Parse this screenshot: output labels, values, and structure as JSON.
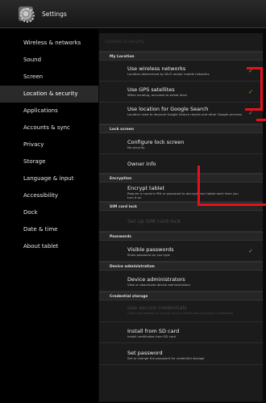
{
  "app": {
    "title": "Settings",
    "icon": "settings-gear-icon"
  },
  "sidebar": {
    "items": [
      {
        "label": "Wireless & networks"
      },
      {
        "label": "Sound"
      },
      {
        "label": "Screen"
      },
      {
        "label": "Location & security",
        "selected": true
      },
      {
        "label": "Applications"
      },
      {
        "label": "Accounts & sync"
      },
      {
        "label": "Privacy"
      },
      {
        "label": "Storage"
      },
      {
        "label": "Language & input"
      },
      {
        "label": "Accessibility"
      },
      {
        "label": "Dock"
      },
      {
        "label": "Date & time"
      },
      {
        "label": "About tablet"
      }
    ]
  },
  "main": {
    "header": "Location & security",
    "sections": {
      "my_location": "My Location",
      "lock_screen": "Lock screen",
      "encryption": "Encryption",
      "sim_lock": "SIM card lock",
      "passwords": "Passwords",
      "device_admin": "Device administration",
      "credential_storage": "Credential storage"
    },
    "items": {
      "wireless_networks": {
        "title": "Use wireless networks",
        "summary": "Location determined by Wi-Fi and/or mobile networks",
        "checked": true
      },
      "gps": {
        "title": "Use GPS satellites",
        "summary": "When locating, accurate to street level",
        "checked": true
      },
      "google_search": {
        "title": "Use location for Google Search",
        "summary": "Location used to improve Google Search results and other Google services",
        "checked": true
      },
      "configure_lock": {
        "title": "Configure lock screen",
        "summary": "No security"
      },
      "owner_info": {
        "title": "Owner info"
      },
      "encrypt_tablet": {
        "title": "Encrypt tablet",
        "summary": "Require a numeric PIN or password to decrypt your tablet each time you turn it on"
      },
      "sim_lock": {
        "title": "Set up SIM card lock",
        "disabled": true
      },
      "visible_passwords": {
        "title": "Visible passwords",
        "summary": "Show password as you type",
        "checked": true
      },
      "device_admins": {
        "title": "Device administrators",
        "summary": "View or deactivate device administrators"
      },
      "secure_credentials": {
        "title": "Use secure credentials",
        "summary": "Allow applications to access secure certificates and other credentials",
        "disabled": true
      },
      "install_sd": {
        "title": "Install from SD card",
        "summary": "Install certificates from SD card"
      },
      "set_password": {
        "title": "Set password",
        "summary": "Set or change the password for credential storage"
      }
    },
    "checkmark": "✓"
  },
  "colors": {
    "annotation_red": "#e8101a",
    "check_green": "#6ec42a"
  }
}
